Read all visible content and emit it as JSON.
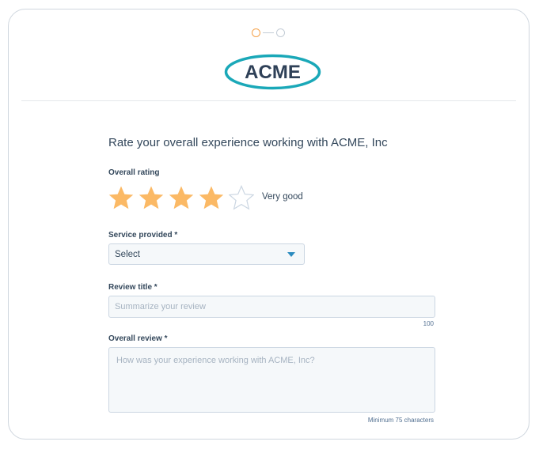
{
  "brand": {
    "logo_text": "ACME",
    "accent_color": "#f5a149",
    "logo_color": "#2e4057",
    "logo_ring_color": "#1aa8b8"
  },
  "progress": {
    "current_step": 1,
    "total_steps": 2
  },
  "form": {
    "heading": "Rate your overall experience working with ACME, Inc",
    "rating": {
      "label": "Overall rating",
      "value": 4,
      "max": 5,
      "text": "Very good"
    },
    "service": {
      "label": "Service provided *",
      "value": "Select"
    },
    "review_title": {
      "label": "Review title *",
      "placeholder": "Summarize your review",
      "value": "",
      "limit_text": "100"
    },
    "overall_review": {
      "label": "Overall review *",
      "placeholder": "How was your experience working with ACME, Inc?",
      "value": "",
      "hint": "Minimum 75 characters"
    }
  }
}
